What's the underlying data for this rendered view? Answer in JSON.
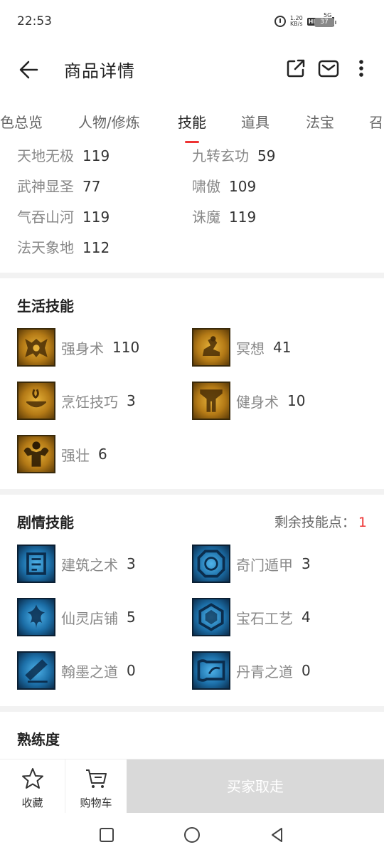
{
  "status": {
    "time": "22:53",
    "speed_top": "1.20",
    "speed_bottom": "KB/s",
    "hd": "HD",
    "network": "5G",
    "battery": "37"
  },
  "header": {
    "title": "商品详情"
  },
  "tabs": [
    {
      "label": "色总览"
    },
    {
      "label": "人物/修炼"
    },
    {
      "label": "技能"
    },
    {
      "label": "道具"
    },
    {
      "label": "法宝"
    },
    {
      "label": "召"
    }
  ],
  "combat_skills": [
    {
      "name": "天地无极",
      "value": "119"
    },
    {
      "name": "九转玄功",
      "value": "59"
    },
    {
      "name": "武神显圣",
      "value": "77"
    },
    {
      "name": "啸傲",
      "value": "109"
    },
    {
      "name": "气吞山河",
      "value": "119"
    },
    {
      "name": "诛魔",
      "value": "119"
    },
    {
      "name": "法天象地",
      "value": "112"
    }
  ],
  "life_skills": {
    "title": "生活技能",
    "items": [
      {
        "name": "强身术",
        "value": "110",
        "icon": "strength-icon"
      },
      {
        "name": "冥想",
        "value": "41",
        "icon": "meditation-icon"
      },
      {
        "name": "烹饪技巧",
        "value": "3",
        "icon": "cooking-icon"
      },
      {
        "name": "健身术",
        "value": "10",
        "icon": "fitness-icon"
      },
      {
        "name": "强壮",
        "value": "6",
        "icon": "muscle-icon"
      }
    ]
  },
  "story_skills": {
    "title": "剧情技能",
    "remaining_label": "剩余技能点：",
    "remaining_value": "1",
    "items": [
      {
        "name": "建筑之术",
        "value": "3",
        "icon": "building-icon"
      },
      {
        "name": "奇门遁甲",
        "value": "3",
        "icon": "qimen-icon"
      },
      {
        "name": "仙灵店铺",
        "value": "5",
        "icon": "shop-icon"
      },
      {
        "name": "宝石工艺",
        "value": "4",
        "icon": "gem-icon"
      },
      {
        "name": "翰墨之道",
        "value": "0",
        "icon": "calligraphy-icon"
      },
      {
        "name": "丹青之道",
        "value": "0",
        "icon": "painting-icon"
      }
    ]
  },
  "proficiency": {
    "title": "熟练度"
  },
  "bottom_bar": {
    "favorite": "收藏",
    "cart": "购物车",
    "buy": "买家取走"
  },
  "colors": {
    "accent": "#ee3333",
    "gold": "#c48a1e",
    "blue": "#1c6fa8",
    "disabled": "#d9d9d9"
  }
}
